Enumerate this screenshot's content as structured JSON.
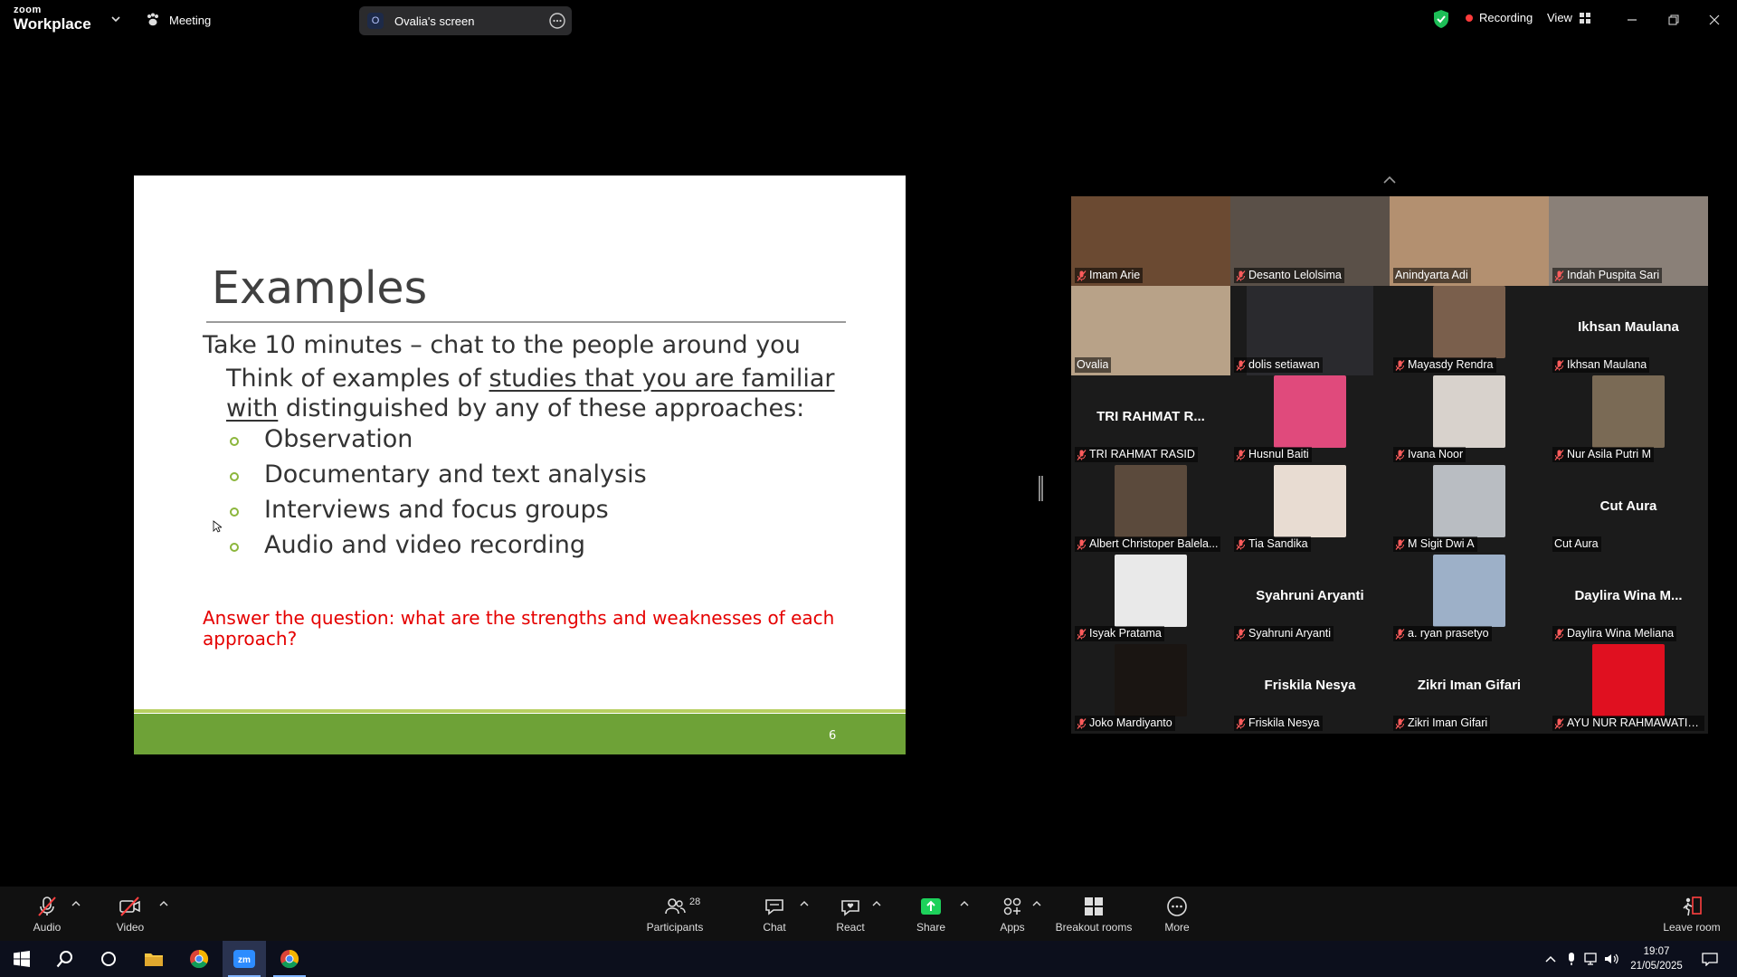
{
  "app": {
    "logo_top": "zoom",
    "logo_bottom": "Workplace",
    "meeting_label": "Meeting",
    "screen_owner_initial": "O",
    "screen_label": "Ovalia's screen",
    "recording_label": "Recording",
    "view_label": "View"
  },
  "slide": {
    "title": "Examples",
    "line1": "Take 10 minutes – chat to the people around you",
    "line2_prefix": "Think of examples of ",
    "line2_underlined": "studies that you are familiar with",
    "line2_suffix": " distinguished by any of these approaches:",
    "bullets": [
      "Observation",
      "Documentary and text analysis",
      "Interviews and focus groups",
      "Audio and video recording"
    ],
    "question": "Answer the question: what are the strengths and weaknesses of each approach?",
    "page_number": "6",
    "colors": {
      "band": "#6ea237",
      "question": "#e50000"
    }
  },
  "gallery": {
    "participants": [
      {
        "name": "Imam Arie",
        "muted": true,
        "video": "full",
        "bg": "#6b4a32"
      },
      {
        "name": "Desanto Lelolsima",
        "muted": true,
        "video": "full",
        "bg": "#5a5048"
      },
      {
        "name": "Anindyarta Adi",
        "muted": false,
        "video": "full",
        "bg": "#b39070"
      },
      {
        "name": "Indah Puspita Sari",
        "muted": true,
        "video": "full",
        "bg": "#8a8078"
      },
      {
        "name": "Ovalia",
        "muted": false,
        "video": "full",
        "bg": "#b8a288",
        "active": true
      },
      {
        "name": "dolis setiawan",
        "muted": true,
        "video": "wide",
        "bg": "#2a2a2e"
      },
      {
        "name": "Mayasdy Rendra",
        "muted": true,
        "video": "sq",
        "bg": "#7a5f4c"
      },
      {
        "name": "Ikhsan Maulana",
        "muted": true,
        "video": "none",
        "display_name": "Ikhsan Maulana"
      },
      {
        "name": "TRI RAHMAT RASID",
        "muted": true,
        "video": "none",
        "display_name": "TRI RAHMAT R..."
      },
      {
        "name": "Husnul Baiti",
        "muted": true,
        "video": "sq",
        "bg": "#e04a7c"
      },
      {
        "name": "Ivana Noor",
        "muted": true,
        "video": "sq",
        "bg": "#d8d2cc"
      },
      {
        "name": "Nur Asila Putri M",
        "muted": true,
        "video": "sq",
        "bg": "#7a6a55"
      },
      {
        "name": "Albert Christoper Balela...",
        "muted": true,
        "video": "sq",
        "bg": "#5b4a3c"
      },
      {
        "name": "Tia Sandika",
        "muted": true,
        "video": "sq",
        "bg": "#e8dcd2"
      },
      {
        "name": "M Sigit Dwi A",
        "muted": true,
        "video": "sq",
        "bg": "#b9bdc2"
      },
      {
        "name": "Cut Aura",
        "muted": false,
        "video": "none",
        "display_name": "Cut Aura"
      },
      {
        "name": "Isyak Pratama",
        "muted": true,
        "video": "sq",
        "bg": "#e9e9e9"
      },
      {
        "name": "Syahruni Aryanti",
        "muted": true,
        "video": "none",
        "display_name": "Syahruni Aryanti"
      },
      {
        "name": "a. ryan prasetyo",
        "muted": true,
        "video": "sq",
        "bg": "#9db0c8"
      },
      {
        "name": "Daylira Wina Meliana",
        "muted": true,
        "video": "none",
        "display_name": "Daylira Wina M..."
      },
      {
        "name": "Joko Mardiyanto",
        "muted": true,
        "video": "sq",
        "bg": "#1a1512"
      },
      {
        "name": "Friskila Nesya",
        "muted": true,
        "video": "none",
        "display_name": "Friskila Nesya"
      },
      {
        "name": "Zikri Iman Gifari",
        "muted": true,
        "video": "none",
        "display_name": "Zikri Iman Gifari"
      },
      {
        "name": "AYU NUR RAHMAWATI, ...",
        "muted": true,
        "video": "sq",
        "bg": "#e01020"
      }
    ]
  },
  "toolbar": {
    "audio": "Audio",
    "video": "Video",
    "participants": "Participants",
    "participants_count": "28",
    "chat": "Chat",
    "react": "React",
    "share": "Share",
    "apps": "Apps",
    "breakout": "Breakout rooms",
    "more": "More",
    "leave": "Leave room",
    "share_color": "#1dd15b"
  },
  "taskbar": {
    "time": "19:07",
    "date": "21/05/2025"
  }
}
